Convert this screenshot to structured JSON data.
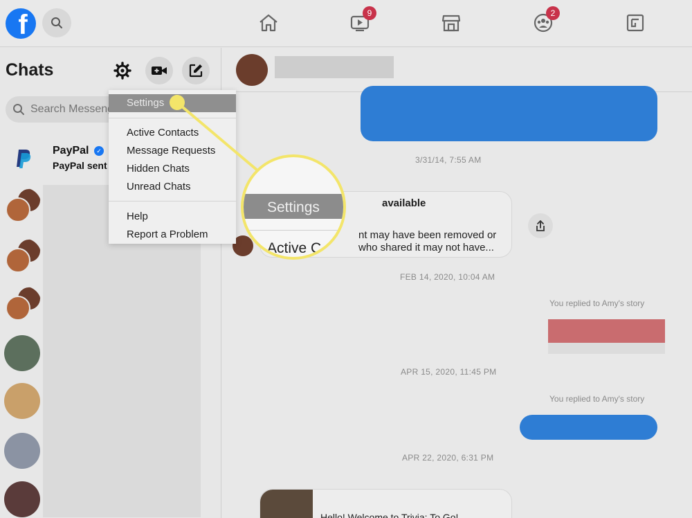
{
  "topnav": {
    "logo": "f",
    "icons": [
      "home-icon",
      "watch-icon",
      "marketplace-icon",
      "groups-icon",
      "gaming-icon"
    ],
    "watch_badge": "9",
    "groups_badge": "2"
  },
  "sidebar": {
    "title": "Chats",
    "search_placeholder": "Search Messenger",
    "paypal": {
      "name": "PayPal",
      "message": "PayPal sent"
    }
  },
  "menu": {
    "items": [
      "Settings",
      "Active Contacts",
      "Message Requests",
      "Hidden Chats",
      "Unread Chats",
      "Help",
      "Report a Problem"
    ],
    "magnified": {
      "item": "Settings",
      "next": "Active C"
    }
  },
  "conversation": {
    "timestamps": [
      "3/31/14, 7:55 AM",
      "FEB 14, 2020, 10:04 AM",
      "APR 15, 2020, 11:45 PM",
      "APR 22, 2020, 6:31 PM"
    ],
    "unavailable": {
      "title": "available",
      "line1": "nt may have been removed or",
      "line2": "who shared it may not have..."
    },
    "reply_label_1": "You replied to Amy's story",
    "reply_label_2": "You replied to Amy's story",
    "trivia_text": "Hello! Welcome to Trivia: To Go!"
  },
  "colors": {
    "accent": "#1877f2",
    "callout": "#f3e56a",
    "badge": "#c8324a",
    "bubble": "#2e7dd4"
  }
}
